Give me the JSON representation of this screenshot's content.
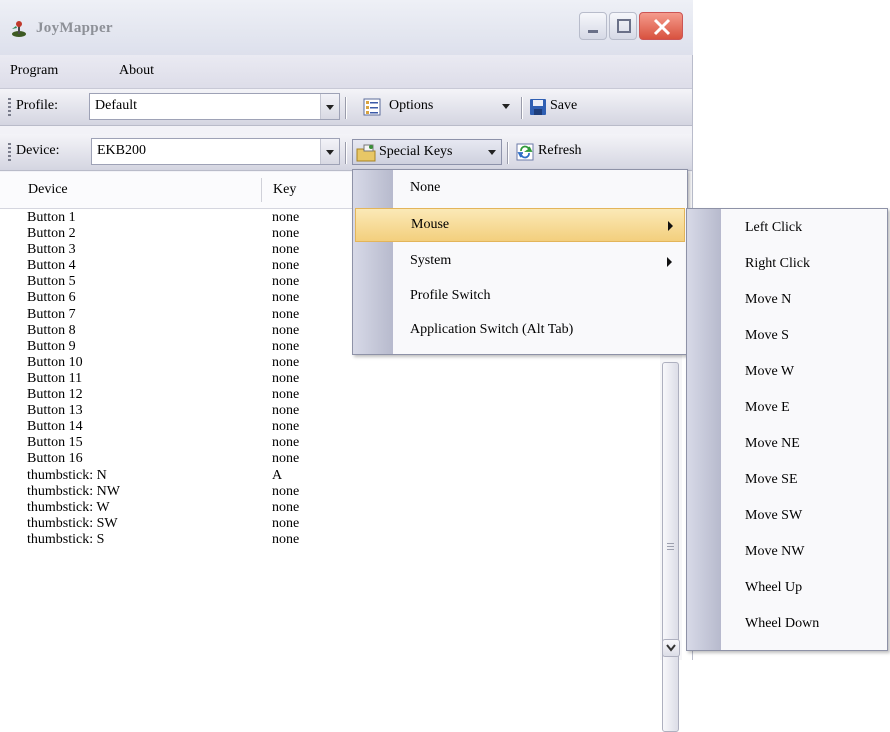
{
  "window": {
    "title": "JoyMapper"
  },
  "menubar": {
    "items": [
      "Program",
      "About"
    ]
  },
  "profile_bar": {
    "label": "Profile:",
    "value": "Default",
    "options_label": "Options",
    "save_label": "Save"
  },
  "device_bar": {
    "label": "Device:",
    "value": "EKB200",
    "special_keys_label": "Special Keys",
    "refresh_label": "Refresh"
  },
  "table": {
    "columns": [
      "Device",
      "Key"
    ],
    "rows": [
      [
        "Button 1",
        "none"
      ],
      [
        "Button 2",
        "none"
      ],
      [
        "Button 3",
        "none"
      ],
      [
        "Button 4",
        "none"
      ],
      [
        "Button 5",
        "none"
      ],
      [
        "Button 6",
        "none"
      ],
      [
        "Button 7",
        "none"
      ],
      [
        "Button 8",
        "none"
      ],
      [
        "Button 9",
        "none"
      ],
      [
        "Button 10",
        "none"
      ],
      [
        "Button 11",
        "none"
      ],
      [
        "Button 12",
        "none"
      ],
      [
        "Button 13",
        "none"
      ],
      [
        "Button 14",
        "none"
      ],
      [
        "Button 15",
        "none"
      ],
      [
        "Button 16",
        "none"
      ],
      [
        "thumbstick: N",
        "A"
      ],
      [
        "thumbstick: NW",
        "none"
      ],
      [
        "thumbstick: W",
        "none"
      ],
      [
        "thumbstick: SW",
        "none"
      ],
      [
        "thumbstick: S",
        "none"
      ]
    ]
  },
  "special_keys_menu": {
    "items": [
      "None",
      "Mouse",
      "System",
      "Profile Switch",
      "Application Switch (Alt Tab)"
    ],
    "highlighted": "Mouse"
  },
  "mouse_submenu": {
    "items": [
      "Left Click",
      "Right Click",
      "Move N",
      "Move S",
      "Move W",
      "Move E",
      "Move NE",
      "Move SE",
      "Move SW",
      "Move NW",
      "Wheel Up",
      "Wheel Down"
    ]
  },
  "colors": {
    "menu_highlight": "#f3cf7d",
    "close_button": "#d8523f",
    "menu_gutter": "#b7bacd"
  },
  "icons": {
    "app": "joystick-icon",
    "options": "options-list-icon",
    "save": "floppy-disk-icon",
    "special_keys": "special-keys-folder-icon",
    "refresh": "refresh-icon"
  }
}
